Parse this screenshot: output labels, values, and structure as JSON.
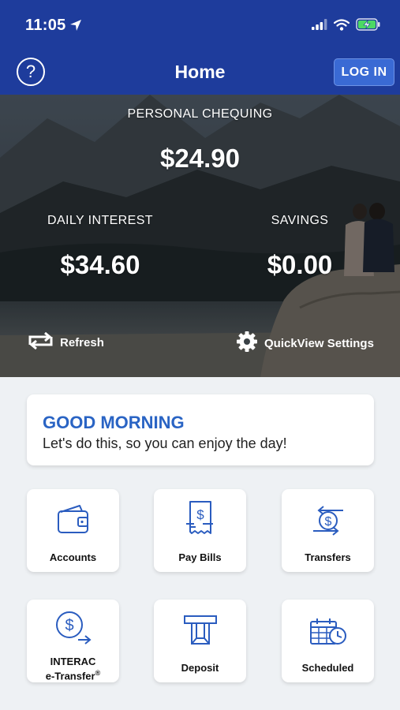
{
  "status_bar": {
    "time": "11:05"
  },
  "header": {
    "help": "?",
    "title": "Home",
    "login_label": "LOG IN"
  },
  "quickview": {
    "primary": {
      "label": "PERSONAL CHEQUING",
      "value": "$24.90"
    },
    "accounts": [
      {
        "label": "DAILY INTEREST",
        "value": "$34.60"
      },
      {
        "label": "SAVINGS",
        "value": "$0.00"
      }
    ],
    "refresh_label": "Refresh",
    "settings_label": "QuickView Settings"
  },
  "greeting": {
    "title": "GOOD MORNING",
    "subtitle": "Let's do this, so you can enjoy the day!"
  },
  "tiles": [
    {
      "label": "Accounts",
      "icon": "wallet-icon"
    },
    {
      "label": "Pay Bills",
      "icon": "bill-icon"
    },
    {
      "label": "Transfers",
      "icon": "transfer-icon"
    },
    {
      "label_line1": "INTERAC",
      "label_line2": "e-Transfer",
      "label_mark": "®",
      "icon": "etransfer-icon"
    },
    {
      "label": "Deposit",
      "icon": "deposit-icon"
    },
    {
      "label": "Scheduled",
      "icon": "calendar-icon"
    }
  ],
  "colors": {
    "brand_blue": "#1e3c9c",
    "button_blue": "#3a6ad4",
    "accent_text": "#2a64c4",
    "icon_blue": "#2a5cbf",
    "background": "#eef1f4"
  }
}
